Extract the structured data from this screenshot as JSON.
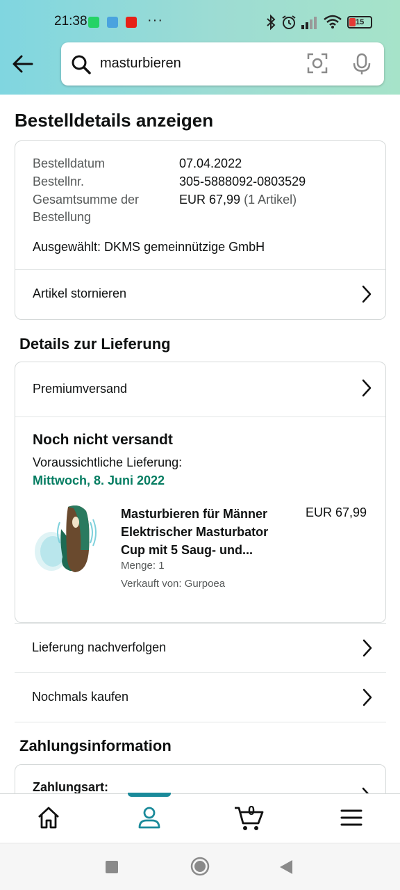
{
  "status_bar": {
    "time": "21:38",
    "more": "···",
    "battery": "15"
  },
  "search": {
    "query": "masturbieren"
  },
  "page_title": "Bestelldetails anzeigen",
  "order": {
    "date_label": "Bestelldatum",
    "date_value": "07.04.2022",
    "number_label": "Bestellnr.",
    "number_value": "305-5888092-0803529",
    "total_label_line1": "Gesamtsumme der",
    "total_label_line2": "Bestellung",
    "total_value": "EUR 67,99",
    "total_items": "(1 Artikel)",
    "selected": "Ausgewählt: DKMS gemeinnützige GmbH",
    "cancel_label": "Artikel stornieren"
  },
  "delivery": {
    "heading": "Details zur Lieferung",
    "shipping_method": "Premiumversand",
    "status": "Noch nicht versandt",
    "expected_label": "Voraussichtliche Lieferung:",
    "expected_date": "Mittwoch, 8. Juni 2022",
    "item": {
      "title_line1": "Masturbieren für Männer",
      "title_line2": "Elektrischer Masturbator",
      "title_line3": "Cup mit 5 Saug- und...",
      "price": "EUR 67,99",
      "quantity": "Menge: 1",
      "seller": "Verkauft von: Gurpoea"
    },
    "track_label": "Lieferung nachverfolgen",
    "buy_again_label": "Nochmals kaufen"
  },
  "payment": {
    "heading": "Zahlungsinformation",
    "method_label": "Zahlungsart:"
  },
  "bottom_nav": {
    "cart_count": "0"
  },
  "colors": {
    "accent": "#1a8a9a",
    "green": "#067d62",
    "border": "#d5d9d9"
  }
}
